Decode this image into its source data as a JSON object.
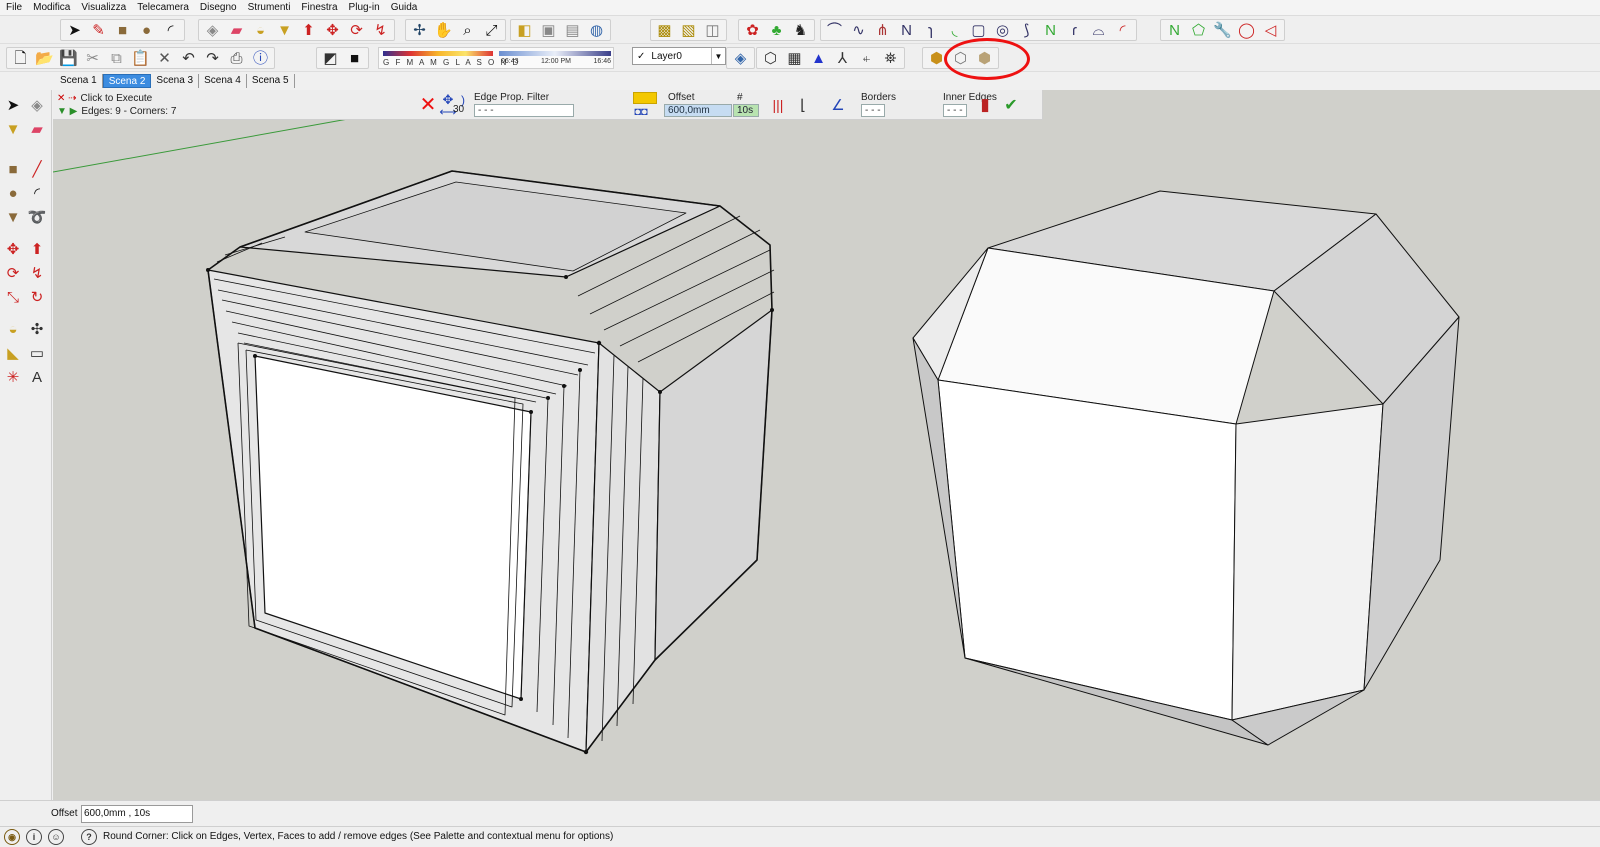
{
  "menu": [
    "File",
    "Modifica",
    "Visualizza",
    "Telecamera",
    "Disegno",
    "Strumenti",
    "Finestra",
    "Plug-in",
    "Guida"
  ],
  "shadow_bar": {
    "months": "G F M A M G L A S O N D",
    "time_start": "06:43",
    "time_mid": "12:00 PM",
    "time_end": "16:46"
  },
  "layer": {
    "check": "✓",
    "name": "Layer0"
  },
  "scenes": [
    "Scena 1",
    "Scena 2",
    "Scena 3",
    "Scena 4",
    "Scena 5"
  ],
  "active_scene": "Scena 2",
  "palette": {
    "line1": "Click to Execute",
    "line2": "Edges: 9 - Corners: 7",
    "segments_value": "30",
    "edge_filter_label": "Edge Prop. Filter",
    "offset_label": "Offset",
    "offset_value": "600,0mm",
    "count_label": "#",
    "count_value": "10s",
    "borders_label": "Borders",
    "inner_edges_label": "Inner Edges",
    "dashes": "- - -"
  },
  "vcb": {
    "label": "Offset",
    "value": "600,0mm , 10s"
  },
  "status": {
    "message": "Round Corner: Click on Edges, Vertex, Faces to add / remove edges (See Palette and contextual menu for options)"
  },
  "colors": {
    "selection_circle": "#e11111",
    "viewport_bg": "#d0d0cb",
    "scene_active": "#3c8ce0"
  }
}
